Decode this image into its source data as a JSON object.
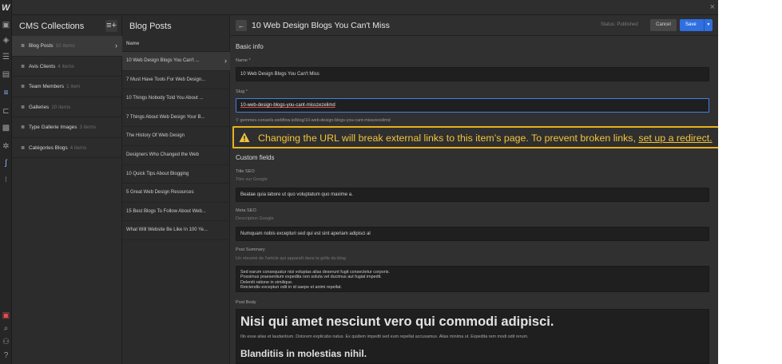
{
  "collections_panel": {
    "title": "CMS Collections",
    "items": [
      {
        "name": "Blog Posts",
        "count": "10 items"
      },
      {
        "name": "Avis Clients",
        "count": "4 items"
      },
      {
        "name": "Team Members",
        "count": "1 item"
      },
      {
        "name": "Galleries",
        "count": "10 items"
      },
      {
        "name": "Type Gallerie Images",
        "count": "3 items"
      },
      {
        "name": "Catégories Blogs",
        "count": "4 items"
      }
    ]
  },
  "items_panel": {
    "title": "Blog Posts",
    "column_header": "Name",
    "items": [
      "10 Web Design Blogs You Can't ...",
      "7 Must Have Tools For Web Design...",
      "10 Things Nobody Told You About ...",
      "7 Things About Web Design Your B...",
      "The History Of Web Design",
      "Designers Who Changed the Web",
      "10 Quick Tips About Blogging",
      "5 Great Web Design Resources",
      "15 Best Blogs To Follow About Web...",
      "What Will Website Be Like In 100 Ye..."
    ]
  },
  "editor": {
    "title": "10 Web Design Blogs You Can't Miss",
    "status": "Status: Published",
    "cancel_label": "Cancel",
    "save_label": "Save",
    "basic_info": {
      "heading": "Basic info",
      "name_label": "Name",
      "name_value": "10 Web Design Blogs You Can't Miss",
      "slug_label": "Slug",
      "slug_value": "10-web-design-blogs-you-cant-misszezelimd",
      "url_prefix": "gemmes-conseils.webflow.io/blog/",
      "url_slug": "10-web-design-blogs-you-cant-misszezelimd"
    },
    "warning": {
      "text": "Changing the URL will break external links to this item’s page. To prevent broken links,",
      "link": "set up a redirect."
    },
    "custom_fields": {
      "heading": "Custom fields",
      "title_seo_label": "Title SEO",
      "title_seo_help": "Titre sur Google",
      "title_seo_value": "Beatae quia labore ut quo voluptatum quo maxime a.",
      "meta_seo_label": "Meta SEO",
      "meta_seo_help": "Description Google",
      "meta_seo_value": "Numquam nobis excepturi sed qui est sint aperiam adipisci al",
      "summary_label": "Post Summary",
      "summary_help": "Un résumé de l'article qui apparaît dans la grille du blog",
      "summary_lines": [
        "Sed earum consequatur nisi voluptas alias deserunt fugit consectetur corporis.",
        "Possimus praesentium expedita non soluta vel ducimus aut fugiat impedit.",
        "Deleniti ratione in similique.",
        "Reiciendis excepturi odit in id saepe et animi repellat."
      ],
      "body_label": "Post Body",
      "body_h1": "Nisi qui amet nesciunt vero qui commodi adipisci.",
      "body_p": "Illo esse alias et laudantium. Dolorem explicabo natus. Ex quidem impedit sed eum repellat accusamus. Alias minima ut. Expedita rem modi odit rerum.",
      "body_h2": "Blanditiis in molestias nihil."
    }
  },
  "colors": {
    "warning": "#e9b11e",
    "accent": "#2f6fe0",
    "background": "#2b2b2b"
  },
  "icons": [
    "webflow-logo-icon",
    "add-icon",
    "cube-icon",
    "navigator-icon",
    "pages-icon",
    "cms-icon",
    "ecommerce-icon",
    "assets-icon",
    "settings-icon",
    "interactions-icon",
    "logic-icon",
    "audit-icon",
    "search-icon",
    "users-icon",
    "help-icon",
    "warning-icon",
    "back-arrow-icon",
    "chevron-right-icon"
  ]
}
